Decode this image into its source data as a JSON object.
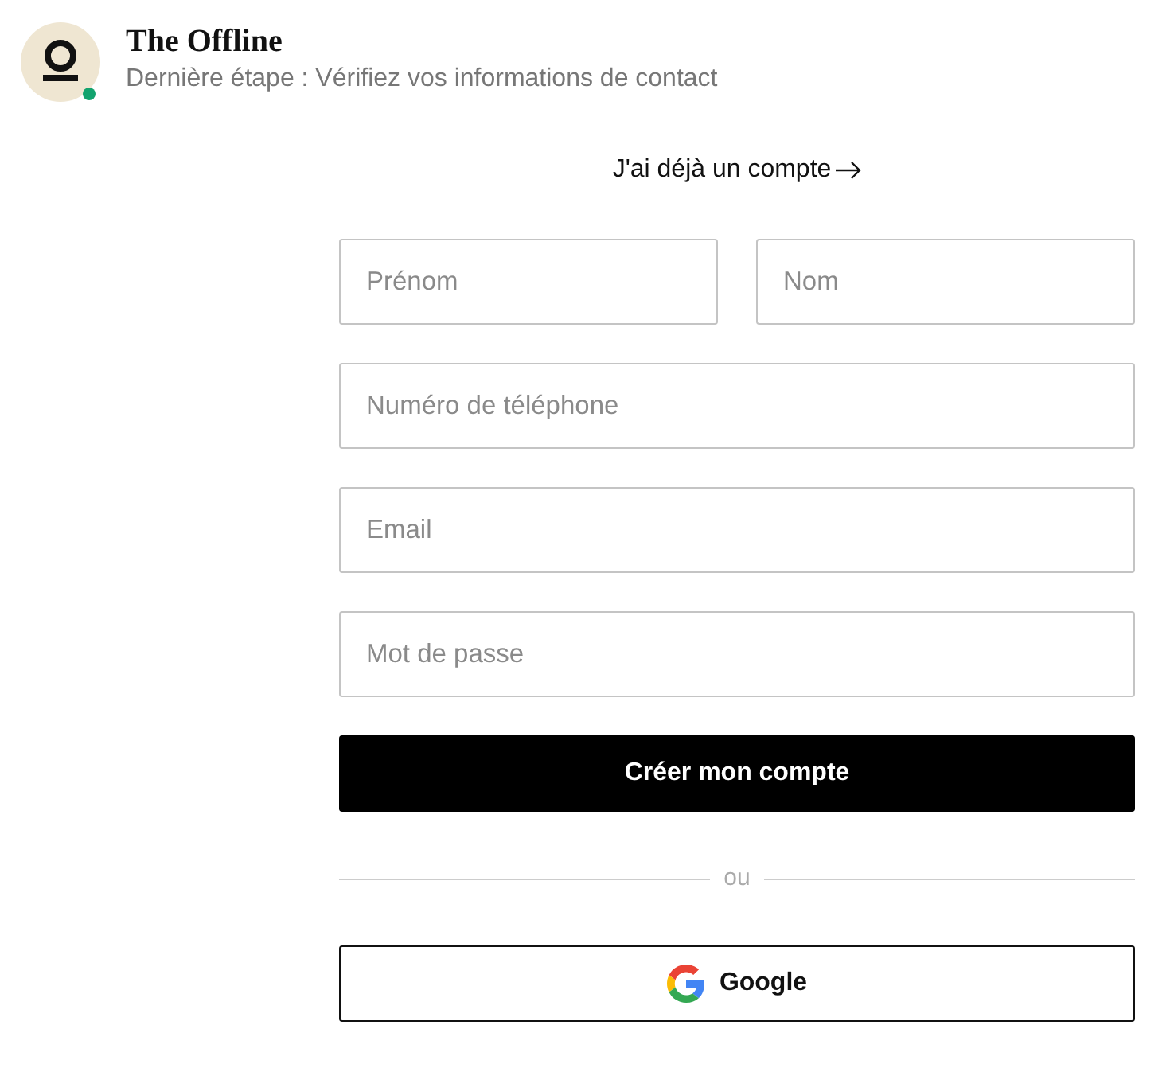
{
  "header": {
    "title": "The Offline",
    "subtitle": "Dernière étape : Vérifiez vos informations de contact",
    "online": true
  },
  "login_link": {
    "label": "J'ai déjà un compte"
  },
  "field_rows": [
    [
      {
        "placeholder": "Prénom"
      },
      {
        "placeholder": "Nom"
      }
    ],
    [
      {
        "placeholder": "Numéro de téléphone"
      }
    ],
    [
      {
        "placeholder": "Email"
      }
    ],
    [
      {
        "placeholder": "Mot de passe"
      }
    ]
  ],
  "submit_button": {
    "label": "Créer mon compte"
  },
  "divider": {
    "label": "ou"
  },
  "google_button": {
    "label": "Google"
  }
}
